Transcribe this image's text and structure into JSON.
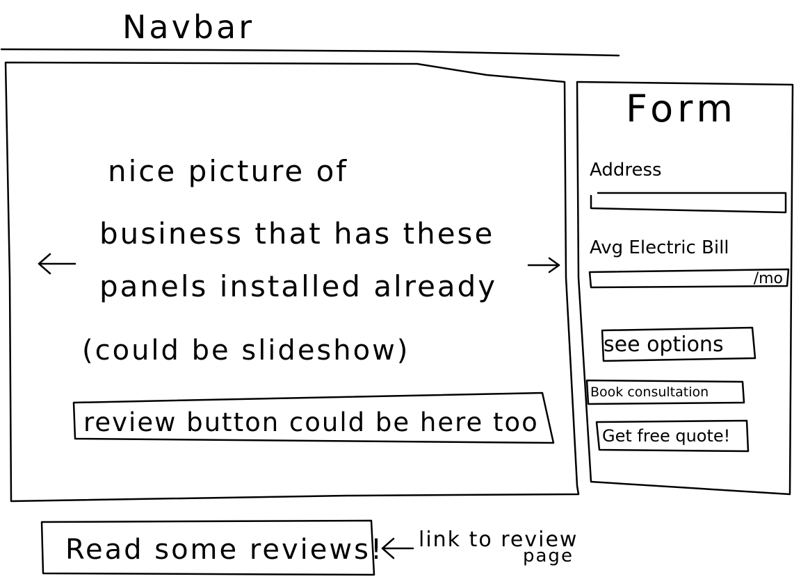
{
  "navbar": {
    "label": "Navbar"
  },
  "hero": {
    "lines": [
      "nice picture of",
      "business that has these",
      "panels installed already",
      "(could be slideshow)"
    ],
    "prev_arrow": "←",
    "next_arrow": "→",
    "review_button_label": "review button could be here too"
  },
  "form": {
    "title": "Form",
    "address_label": "Address",
    "address_value": "",
    "bill_label": "Avg Electric Bill",
    "bill_value": "/mo",
    "see_options_label": "see options",
    "book_consultation_label": "Book consultation",
    "free_quote_label": "Get free quote!"
  },
  "footer": {
    "read_reviews_label": "Read some reviews!",
    "annotation_line1": "link to review",
    "annotation_line2": "page"
  }
}
